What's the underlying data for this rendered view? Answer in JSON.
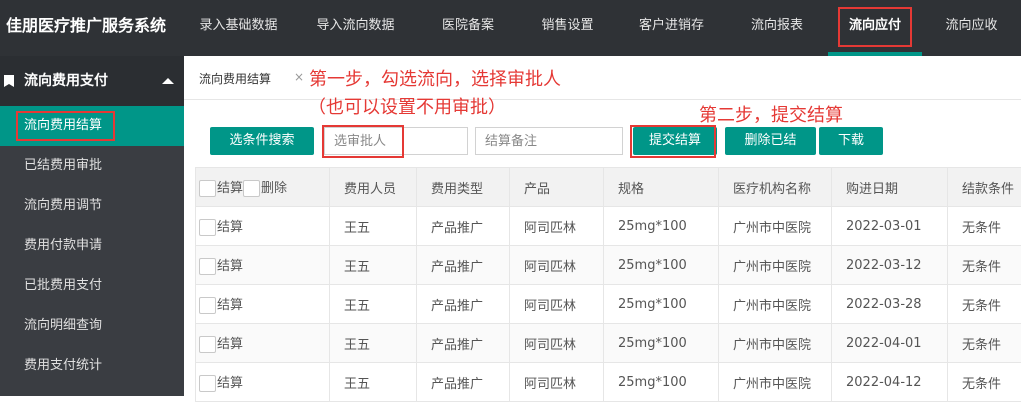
{
  "app": {
    "title": "佳朋医疗推广服务系统"
  },
  "nav": {
    "items": [
      {
        "label": "录入基础数据"
      },
      {
        "label": "导入流向数据"
      },
      {
        "label": "医院备案"
      },
      {
        "label": "销售设置"
      },
      {
        "label": "客户进销存"
      },
      {
        "label": "流向报表"
      },
      {
        "label": "流向应付",
        "active": true
      },
      {
        "label": "流向应收"
      }
    ]
  },
  "sidebar": {
    "group": "流向费用支付",
    "items": [
      {
        "label": "流向费用结算",
        "active": true
      },
      {
        "label": "已结费用审批"
      },
      {
        "label": "流向费用调节"
      },
      {
        "label": "费用付款申请"
      },
      {
        "label": "已批费用支付"
      },
      {
        "label": "流向明细查询"
      },
      {
        "label": "费用支付统计"
      }
    ]
  },
  "tab": {
    "label": "流向费用结算",
    "close": "×"
  },
  "annotations": {
    "step1_line1": "第一步，勾选流向，选择审批人",
    "step1_line2": "（也可以设置不用审批）",
    "step2": "第二步，提交结算"
  },
  "toolbar": {
    "search_button": "选条件搜索",
    "approver_placeholder": "选审批人",
    "remark_placeholder": "结算备注",
    "submit_button": "提交结算",
    "delete_button": "删除已结",
    "download_button": "下载"
  },
  "table": {
    "headers": {
      "settle": "结算",
      "delete": "删除",
      "columns": [
        "费用人员",
        "费用类型",
        "产品",
        "规格",
        "医疗机构名称",
        "购进日期",
        "结款条件"
      ]
    },
    "rows": [
      {
        "check": "结算",
        "cells": [
          "王五",
          "产品推广",
          "阿司匹林",
          "25mg*100",
          "广州市中医院",
          "2022-03-01",
          "无条件"
        ]
      },
      {
        "check": "结算",
        "cells": [
          "王五",
          "产品推广",
          "阿司匹林",
          "25mg*100",
          "广州市中医院",
          "2022-03-12",
          "无条件"
        ]
      },
      {
        "check": "结算",
        "cells": [
          "王五",
          "产品推广",
          "阿司匹林",
          "25mg*100",
          "广州市中医院",
          "2022-03-28",
          "无条件"
        ]
      },
      {
        "check": "结算",
        "cells": [
          "王五",
          "产品推广",
          "阿司匹林",
          "25mg*100",
          "广州市中医院",
          "2022-04-01",
          "无条件"
        ]
      },
      {
        "check": "结算",
        "cells": [
          "王五",
          "产品推广",
          "阿司匹林",
          "25mg*100",
          "广州市中医院",
          "2022-04-12",
          "无条件"
        ]
      }
    ]
  }
}
